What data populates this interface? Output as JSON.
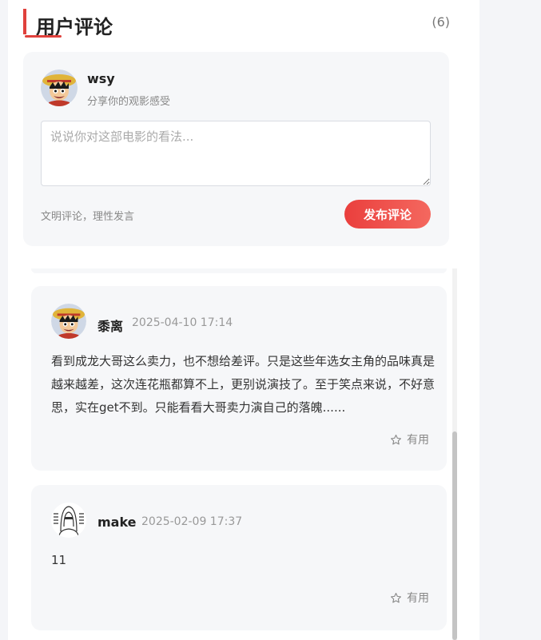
{
  "header": {
    "title": "用户评论",
    "count": "(6)",
    "accent_color": "#e0413c"
  },
  "compose": {
    "username": "wsy",
    "subtitle": "分享你的观影感受",
    "placeholder": "说说你对这部电影的看法...",
    "hint": "文明评论，理性发言",
    "submit_label": "发布评论",
    "avatar_icon": "luffy-avatar-icon"
  },
  "comments": [
    {
      "username": "黍离",
      "time": "2025-04-10 17:14",
      "text": "看到成龙大哥这么卖力，也不想给差评。只是这些年选女主角的品味真是越来越差，这次连花瓶都算不上，更别说演技了。至于笑点来说，不好意思，实在get不到。只能看看大哥卖力演自己的落魄......",
      "useful_label": "有用",
      "avatar_icon": "luffy-avatar-icon"
    },
    {
      "username": "make",
      "time": "2025-02-09 17:37",
      "text": "11",
      "useful_label": "有用",
      "avatar_icon": "hacker-avatar-icon"
    }
  ]
}
